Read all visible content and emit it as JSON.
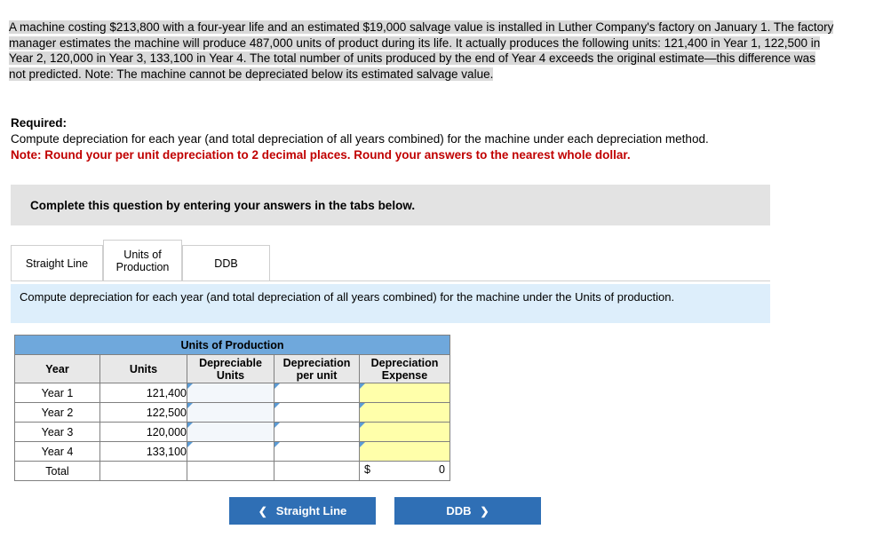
{
  "problem": {
    "highlighted_text": "A machine costing $213,800 with a four-year life and an estimated $19,000 salvage value is installed in Luther Company's factory on January 1. The factory manager estimates the machine will produce 487,000 units of product during its life. It actually produces the following units: 121,400 in Year 1, 122,500 in Year 2, 120,000 in Year 3, 133,100 in Year 4. The total number of units produced by the end of Year 4 exceeds the original estimate—this difference was not predicted. Note: The machine cannot be depreciated below its estimated salvage value."
  },
  "required": {
    "title": "Required:",
    "text": "Compute depreciation for each year (and total depreciation of all years combined) for the machine under each depreciation method.",
    "note": "Note: Round your per unit depreciation to 2 decimal places. Round your answers to the nearest whole dollar."
  },
  "instruction_bar": {
    "text": "Complete this question by entering your answers in the tabs below."
  },
  "tabs": [
    {
      "label": "Straight Line",
      "active": false
    },
    {
      "label": "Units of Production",
      "active": true
    },
    {
      "label": "DDB",
      "active": false
    }
  ],
  "info_bar": {
    "text": "Compute depreciation for each year (and total depreciation of all years combined) for the machine under the Units of production."
  },
  "table": {
    "title": "Units of Production",
    "columns": [
      "Year",
      "Units",
      "Depreciable Units",
      "Depreciation per unit",
      "Depreciation Expense"
    ],
    "rows": [
      {
        "year": "Year 1",
        "units": "121,400",
        "depreciable_units": "",
        "per_unit": "",
        "expense": ""
      },
      {
        "year": "Year 2",
        "units": "122,500",
        "depreciable_units": "",
        "per_unit": "",
        "expense": ""
      },
      {
        "year": "Year 3",
        "units": "120,000",
        "depreciable_units": "",
        "per_unit": "",
        "expense": ""
      },
      {
        "year": "Year 4",
        "units": "133,100",
        "depreciable_units": "",
        "per_unit": "",
        "expense": ""
      }
    ],
    "total": {
      "label": "Total",
      "units": "",
      "depreciable_units": "",
      "per_unit": "",
      "expense_symbol": "$",
      "expense_value": "0"
    }
  },
  "nav": {
    "prev_label": "Straight Line",
    "prev_icon": "chevron-left-icon",
    "next_label": "DDB",
    "next_icon": "chevron-right-icon"
  },
  "colors": {
    "tab_panel_info": "#ddeefb",
    "table_header_blue": "#6fa8dc",
    "input_yellow": "#ffffaa",
    "button_blue": "#2f6fb5",
    "note_red": "#c00000"
  }
}
